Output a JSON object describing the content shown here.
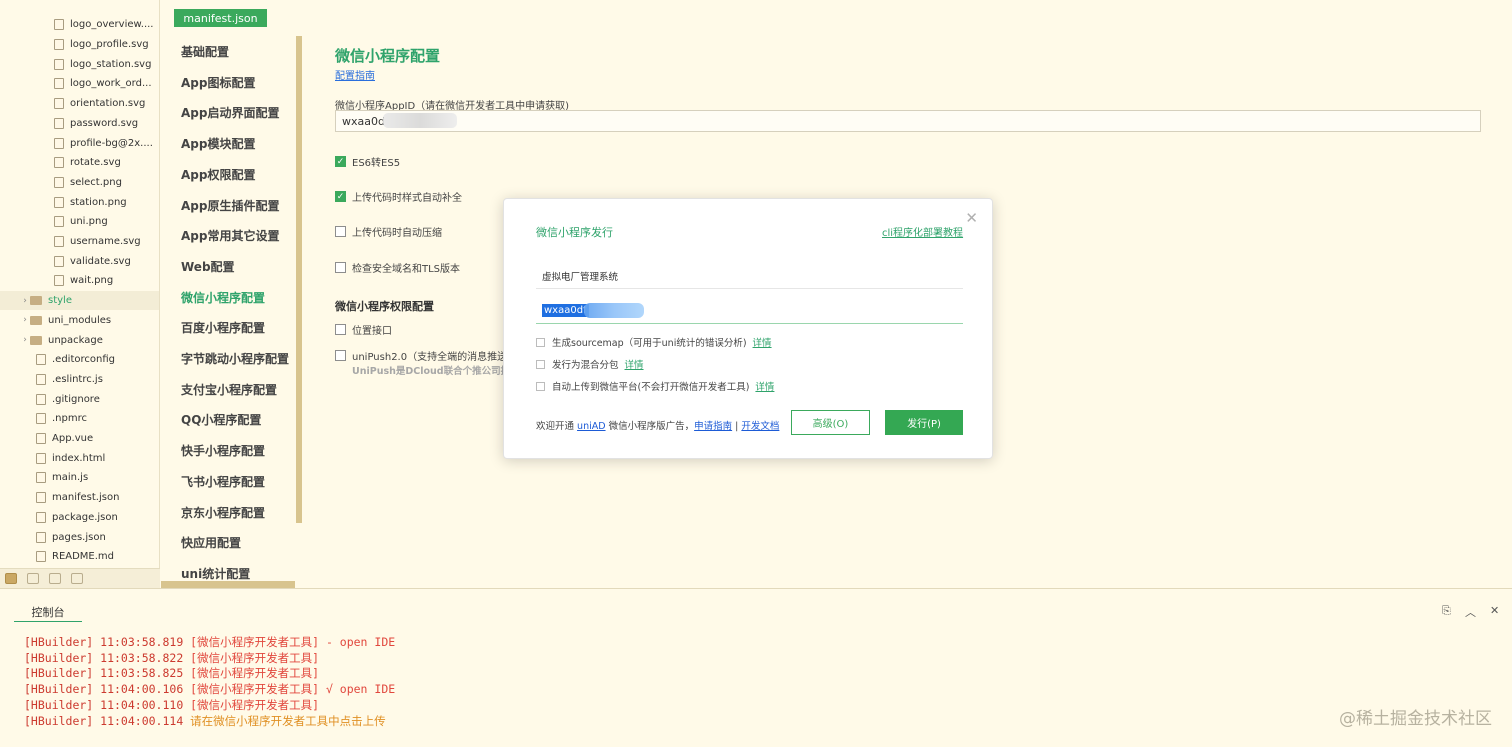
{
  "file_tree": {
    "items": [
      {
        "label": "logo_overview....",
        "kind": "file",
        "indent": 2
      },
      {
        "label": "logo_profile.svg",
        "kind": "file",
        "indent": 2
      },
      {
        "label": "logo_station.svg",
        "kind": "file",
        "indent": 2
      },
      {
        "label": "logo_work_ord...",
        "kind": "file",
        "indent": 2
      },
      {
        "label": "orientation.svg",
        "kind": "file",
        "indent": 2
      },
      {
        "label": "password.svg",
        "kind": "file",
        "indent": 2
      },
      {
        "label": "profile-bg@2x....",
        "kind": "file",
        "indent": 2
      },
      {
        "label": "rotate.svg",
        "kind": "file",
        "indent": 2
      },
      {
        "label": "select.png",
        "kind": "file",
        "indent": 2
      },
      {
        "label": "station.png",
        "kind": "file",
        "indent": 2
      },
      {
        "label": "uni.png",
        "kind": "file",
        "indent": 2
      },
      {
        "label": "username.svg",
        "kind": "file",
        "indent": 2
      },
      {
        "label": "validate.svg",
        "kind": "file",
        "indent": 2
      },
      {
        "label": "wait.png",
        "kind": "file",
        "indent": 2
      },
      {
        "label": "style",
        "kind": "folder",
        "indent": 1,
        "highlight": true
      },
      {
        "label": "uni_modules",
        "kind": "folder",
        "indent": 1
      },
      {
        "label": "unpackage",
        "kind": "folder",
        "indent": 1
      },
      {
        "label": ".editorconfig",
        "kind": "file",
        "indent": 1
      },
      {
        "label": ".eslintrc.js",
        "kind": "file",
        "indent": 1
      },
      {
        "label": ".gitignore",
        "kind": "file",
        "indent": 1
      },
      {
        "label": ".npmrc",
        "kind": "file",
        "indent": 1
      },
      {
        "label": "App.vue",
        "kind": "file",
        "indent": 1
      },
      {
        "label": "index.html",
        "kind": "file",
        "indent": 1
      },
      {
        "label": "main.js",
        "kind": "file",
        "indent": 1
      },
      {
        "label": "manifest.json",
        "kind": "file",
        "indent": 1
      },
      {
        "label": "package.json",
        "kind": "file",
        "indent": 1
      },
      {
        "label": "pages.json",
        "kind": "file",
        "indent": 1
      },
      {
        "label": "README.md",
        "kind": "file",
        "indent": 1
      }
    ]
  },
  "settings_nav": {
    "tab": "manifest.json",
    "items": [
      {
        "label": "基础配置"
      },
      {
        "label": "App图标配置"
      },
      {
        "label": "App启动界面配置"
      },
      {
        "label": "App模块配置"
      },
      {
        "label": "App权限配置"
      },
      {
        "label": "App原生插件配置"
      },
      {
        "label": "App常用其它设置"
      },
      {
        "label": "Web配置"
      },
      {
        "label": "微信小程序配置",
        "active": true
      },
      {
        "label": "百度小程序配置"
      },
      {
        "label": "字节跳动小程序配置"
      },
      {
        "label": "支付宝小程序配置"
      },
      {
        "label": "QQ小程序配置"
      },
      {
        "label": "快手小程序配置"
      },
      {
        "label": "飞书小程序配置"
      },
      {
        "label": "京东小程序配置"
      },
      {
        "label": "快应用配置"
      },
      {
        "label": "uni统计配置"
      }
    ]
  },
  "main": {
    "title": "微信小程序配置",
    "guide_link": "配置指南",
    "appid_label": "微信小程序AppID（请在微信开发者工具中申请获取)",
    "appid_value": "wxaa0d",
    "options": {
      "es6": "ES6转ES5",
      "autoprefix": "上传代码时样式自动补全",
      "minify": "上传代码时自动压缩",
      "tls": "检查安全域名和TLS版本"
    },
    "permissions_title": "微信小程序权限配置",
    "location": "位置接口",
    "unipush": "uniPush2.0（支持全端的消息推送",
    "unipush_desc": "UniPush是DCloud联合个推公司推"
  },
  "modal": {
    "title": "微信小程序发行",
    "cli_link": "cli程序化部署教程",
    "project_name": "虚拟电厂管理系统",
    "appid_value": "wxaa0df",
    "sourcemap_label": "生成sourcemap（可用于uni统计的错误分析)",
    "subpackage_label": "发行为混合分包",
    "autoupload_label": "自动上传到微信平台(不会打开微信开发者工具)",
    "detail": "详情",
    "ad_prefix": "欢迎开通",
    "ad_brand": "uniAD",
    "ad_suffix": "微信小程序版广告，",
    "ad_apply": "申请指南",
    "ad_sep": "|",
    "ad_docs": "开发文档",
    "advanced_button": "高级(O)",
    "publish_button": "发行(P)"
  },
  "console": {
    "tab": "控制台",
    "lines": [
      {
        "prefix": "[HBuilder] 11:03:58.819 ",
        "msg": "[微信小程序开发者工具] - open IDE",
        "tone": "red"
      },
      {
        "prefix": "[HBuilder] 11:03:58.822 ",
        "msg": "[微信小程序开发者工具]",
        "tone": "red"
      },
      {
        "prefix": "[HBuilder] 11:03:58.825 ",
        "msg": "[微信小程序开发者工具]",
        "tone": "red"
      },
      {
        "prefix": "[HBuilder] 11:04:00.106 ",
        "msg": "[微信小程序开发者工具] √ open IDE",
        "tone": "red"
      },
      {
        "prefix": "[HBuilder] 11:04:00.110 ",
        "msg": "[微信小程序开发者工具]",
        "tone": "red"
      },
      {
        "prefix": "[HBuilder] 11:04:00.114 ",
        "msg": "请在微信小程序开发者工具中点击上传",
        "tone": "orange"
      }
    ]
  },
  "watermark": "@稀土掘金技术社区",
  "colors": {
    "accent": "#2fa36b",
    "button_green": "#34a853",
    "error_red": "#e1473d",
    "warn_orange": "#e09024",
    "background": "#fffae8"
  }
}
